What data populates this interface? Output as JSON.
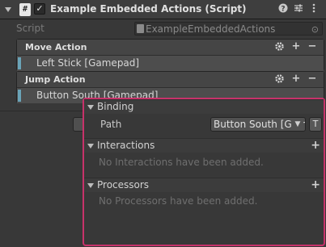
{
  "header": {
    "script_icon": "#",
    "checked": "✓",
    "title": "Example Embedded Actions (Script)",
    "icons": [
      "help-icon",
      "settings-sliders-icon",
      "more-menu-icon"
    ]
  },
  "script_field": {
    "label": "Script",
    "value": "ExampleEmbeddedActions"
  },
  "actions": [
    {
      "title": "Move Action",
      "binding": "Left Stick [Gamepad]"
    },
    {
      "title": "Jump Action",
      "binding": "Button South [Gamepad]"
    }
  ],
  "popup": {
    "binding_section": "Binding",
    "path_label": "Path",
    "path_value": "Button South [Gamepad]",
    "t_label": "T",
    "interactions_section": "Interactions",
    "interactions_empty": "No Interactions have been added.",
    "processors_section": "Processors",
    "processors_empty": "No Processors have been added."
  },
  "colors": {
    "popup_border": "#c8326a",
    "row_indicator": "#6aa4b8"
  }
}
